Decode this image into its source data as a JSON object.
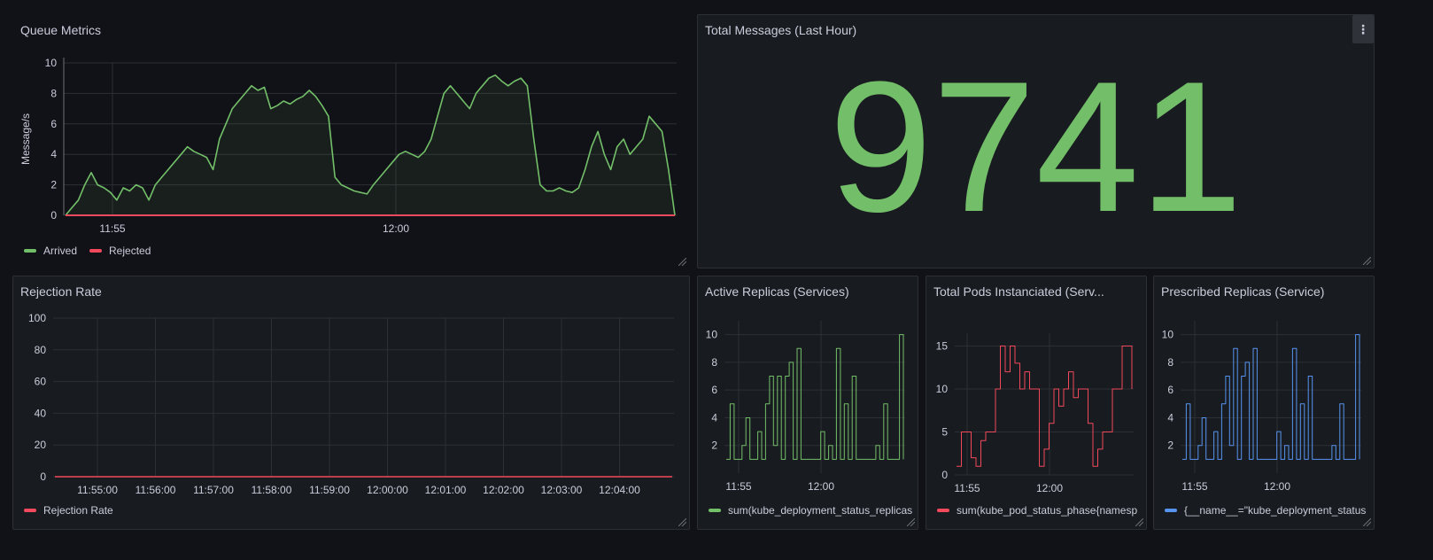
{
  "colors": {
    "arrived": "#73bf69",
    "rejected": "#f2495c",
    "prescribed": "#5794f2",
    "grid": "#2c2f36",
    "axis": "#ccccdc"
  },
  "panels": {
    "queue_metrics": {
      "title": "Queue Metrics",
      "ylabel": "Message/s",
      "yticks": [
        "10",
        "8",
        "6",
        "4",
        "2",
        "0"
      ],
      "xticks": [
        "11:55",
        "12:00"
      ],
      "legend": [
        {
          "label": "Arrived",
          "color": "#73bf69"
        },
        {
          "label": "Rejected",
          "color": "#f2495c"
        }
      ]
    },
    "total_messages": {
      "title": "Total Messages (Last Hour)",
      "value": "9741",
      "menu_icon": "⋮"
    },
    "rejection_rate": {
      "title": "Rejection Rate",
      "yticks": [
        "100",
        "80",
        "60",
        "40",
        "20",
        "0"
      ],
      "xticks": [
        "11:55:00",
        "11:56:00",
        "11:57:00",
        "11:58:00",
        "11:59:00",
        "12:00:00",
        "12:01:00",
        "12:02:00",
        "12:03:00",
        "12:04:00"
      ],
      "legend": [
        {
          "label": "Rejection Rate",
          "color": "#f2495c"
        }
      ]
    },
    "active_replicas": {
      "title": "Active Replicas (Services)",
      "yticks": [
        "10",
        "8",
        "6",
        "4",
        "2"
      ],
      "xticks": [
        "11:55",
        "12:00"
      ],
      "legend": [
        {
          "label": "sum(kube_deployment_status_replicas",
          "color": "#73bf69"
        }
      ]
    },
    "total_pods": {
      "title": "Total Pods Instanciated (Serv...",
      "yticks": [
        "15",
        "10",
        "5",
        "0"
      ],
      "xticks": [
        "11:55",
        "12:00"
      ],
      "legend": [
        {
          "label": "sum(kube_pod_status_phase{namesp",
          "color": "#f2495c"
        }
      ]
    },
    "prescribed_replicas": {
      "title": "Prescribed Replicas (Service)",
      "yticks": [
        "10",
        "8",
        "6",
        "4",
        "2"
      ],
      "xticks": [
        "11:55",
        "12:00"
      ],
      "legend": [
        {
          "label": "{__name__=\"kube_deployment_status",
          "color": "#5794f2"
        }
      ]
    }
  },
  "chart_data": [
    {
      "type": "area",
      "title": "Queue Metrics",
      "ylabel": "Message/s",
      "ylim": [
        0,
        10
      ],
      "x_ticks": [
        "11:55",
        "12:00"
      ],
      "series": [
        {
          "name": "Arrived",
          "values": [
            0,
            0.5,
            1,
            2,
            2.8,
            2,
            1.8,
            1.5,
            1,
            1.8,
            1.6,
            2,
            1.8,
            1,
            2,
            2.5,
            3,
            3.5,
            4,
            4.5,
            4.2,
            4,
            3.8,
            3,
            5,
            6,
            7,
            7.5,
            8,
            8.5,
            8.2,
            8.4,
            7,
            7.2,
            7.5,
            7.3,
            7.6,
            7.8,
            8.2,
            7.8,
            7.2,
            6.5,
            2.5,
            2,
            1.8,
            1.6,
            1.5,
            1.4,
            2,
            2.5,
            3,
            3.5,
            4,
            4.2,
            4,
            3.8,
            4.2,
            5,
            6.5,
            8,
            8.5,
            8,
            7.5,
            7,
            8,
            8.5,
            9,
            9.2,
            8.8,
            8.5,
            8.8,
            9,
            8.5,
            5,
            2,
            1.6,
            1.6,
            1.8,
            1.6,
            1.5,
            1.8,
            3,
            4.5,
            5.5,
            4,
            3,
            4.5,
            5,
            4,
            4.5,
            5,
            6.5,
            6,
            5.5,
            3,
            0
          ]
        },
        {
          "name": "Rejected",
          "values": [
            0,
            0,
            0,
            0,
            0,
            0,
            0,
            0,
            0,
            0,
            0,
            0,
            0,
            0,
            0,
            0,
            0,
            0,
            0,
            0,
            0,
            0,
            0,
            0,
            0,
            0,
            0,
            0,
            0,
            0,
            0,
            0,
            0,
            0,
            0,
            0,
            0,
            0,
            0,
            0,
            0,
            0,
            0,
            0,
            0,
            0,
            0,
            0,
            0,
            0,
            0,
            0,
            0,
            0,
            0,
            0,
            0,
            0,
            0,
            0,
            0,
            0,
            0,
            0,
            0,
            0,
            0,
            0,
            0,
            0,
            0,
            0,
            0,
            0,
            0,
            0,
            0,
            0,
            0,
            0,
            0,
            0,
            0,
            0,
            0,
            0,
            0,
            0,
            0,
            0,
            0,
            0,
            0,
            0,
            0,
            0
          ]
        }
      ]
    },
    {
      "type": "line",
      "title": "Rejection Rate",
      "ylim": [
        0,
        100
      ],
      "x_ticks": [
        "11:55:00",
        "11:56:00",
        "11:57:00",
        "11:58:00",
        "11:59:00",
        "12:00:00",
        "12:01:00",
        "12:02:00",
        "12:03:00",
        "12:04:00"
      ],
      "series": [
        {
          "name": "Rejection Rate",
          "values": [
            0,
            0,
            0,
            0,
            0,
            0,
            0,
            0,
            0,
            0,
            0
          ]
        }
      ]
    },
    {
      "type": "line",
      "title": "Active Replicas (Services)",
      "ylim": [
        1,
        10
      ],
      "series": [
        {
          "name": "sum(kube_deployment_status_replicas",
          "values": [
            1,
            5,
            1,
            1,
            2,
            4,
            1,
            1,
            3,
            1,
            5,
            7,
            2,
            7,
            1,
            7,
            8,
            1,
            9,
            1,
            1,
            1,
            1,
            1,
            3,
            1,
            2,
            1,
            9,
            1,
            5,
            1,
            7,
            1,
            1,
            1,
            1,
            1,
            2,
            1,
            5,
            1,
            1,
            1,
            10,
            1
          ]
        }
      ]
    },
    {
      "type": "line",
      "title": "Total Pods Instanciated (Serv...",
      "ylim": [
        0,
        15
      ],
      "series": [
        {
          "name": "sum(kube_pod_status_phase{namesp",
          "values": [
            1,
            5,
            5,
            2,
            1,
            4,
            5,
            5,
            10,
            15,
            12,
            15,
            13,
            10,
            12,
            10,
            10,
            1,
            3,
            6,
            10,
            8,
            10,
            12,
            9,
            10,
            10,
            6,
            1,
            3,
            5,
            5,
            10,
            10,
            15,
            15,
            10
          ]
        }
      ]
    },
    {
      "type": "line",
      "title": "Prescribed Replicas (Service)",
      "ylim": [
        1,
        10
      ],
      "series": [
        {
          "name": "{__name__=\"kube_deployment_status",
          "values": [
            1,
            5,
            1,
            1,
            2,
            4,
            1,
            1,
            3,
            1,
            5,
            7,
            2,
            9,
            1,
            7,
            8,
            1,
            9,
            1,
            1,
            1,
            1,
            1,
            3,
            1,
            2,
            1,
            9,
            1,
            5,
            1,
            7,
            1,
            1,
            1,
            1,
            1,
            2,
            1,
            5,
            1,
            1,
            1,
            10,
            1
          ]
        }
      ]
    }
  ]
}
